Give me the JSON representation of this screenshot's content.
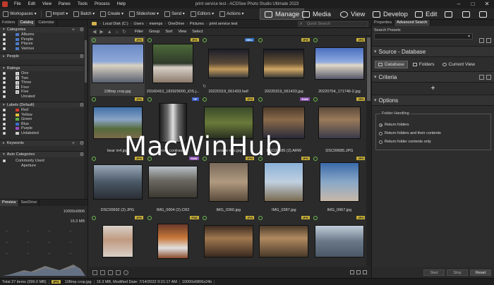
{
  "titlebar": {
    "menu": [
      "File",
      "Edit",
      "View",
      "Panes",
      "Tools",
      "Process",
      "Help"
    ],
    "title": "print service test - ACDSee Photo Studio Ultimate 2023"
  },
  "toolbar": {
    "buttons": [
      "Workspaces",
      "Import",
      "Batch",
      "Create",
      "Slideshow",
      "Send",
      "Editors",
      "Actions"
    ],
    "modes": [
      "Manage",
      "Media",
      "View",
      "Develop",
      "Edit"
    ]
  },
  "left_panel": {
    "tabs": [
      "Folders",
      "Catalog",
      "Calendar"
    ],
    "categories": {
      "title": "Categories",
      "items": [
        "Albums",
        "People",
        "Places",
        "Various"
      ],
      "colors": [
        "#4a7cc8",
        "#4a7cc8",
        "#4a7cc8",
        "#4a7cc8"
      ]
    },
    "people": {
      "title": "People"
    },
    "ratings": {
      "title": "Ratings",
      "items": [
        "One",
        "Two",
        "Three",
        "Four",
        "Five",
        "Unrated"
      ],
      "numbers": [
        "1",
        "2",
        "3",
        "4",
        "5",
        ""
      ]
    },
    "labels": {
      "title": "Labels (Default)",
      "items": [
        "Red",
        "Yellow",
        "Green",
        "Blue",
        "Purple",
        "Unlabeled"
      ],
      "colors": [
        "#d23b2e",
        "#e6c53a",
        "#58b048",
        "#3a6fd0",
        "#9a4bc0",
        "#cccccc"
      ]
    },
    "keywords": {
      "title": "Keywords"
    },
    "auto_categories": {
      "title": "Auto Categories",
      "items": [
        "Commonly Used",
        "Aperture"
      ]
    }
  },
  "preview": {
    "tabs": [
      "Preview",
      "SeeDrive"
    ],
    "dimensions": "10000x6806",
    "filesize": "15.3 MB",
    "dashes": [
      "--",
      "--",
      "--",
      "--",
      "--",
      "--",
      "--",
      "--",
      "--",
      "--",
      "--",
      "--"
    ]
  },
  "address": {
    "crumbs": [
      "Local Disk (C:)",
      "Users",
      "mwmps",
      "OneDrive",
      "Pictures",
      "print service test"
    ],
    "search_placeholder": "Quick Search"
  },
  "filterbar": {
    "buttons": [
      "Filter",
      "Group",
      "Sort",
      "View",
      "Select"
    ]
  },
  "grid": {
    "items": [
      {
        "name": "108mp crop.jpg",
        "badge": "JPG",
        "btype": "jpg",
        "sel": true
      },
      {
        "name": "20160410_183929000_iOS.j...",
        "badge": "JPG",
        "btype": "jpg",
        "sel": false
      },
      {
        "name": "20220319_061433.heif",
        "badge": "HEIC",
        "btype": "heic",
        "sel": false
      },
      {
        "name": "20220319_061433.jpg",
        "badge": "JPG",
        "btype": "jpg",
        "sel": false
      },
      {
        "name": "20220704_171746-2.jpg",
        "badge": "JPG",
        "btype": "jpg",
        "sel": false
      },
      {
        "name": "bear m4.jpg",
        "badge": "JPG",
        "btype": "jpg",
        "sel": false
      },
      {
        "name": "brook contrast.tif",
        "badge": "TIF",
        "btype": "tif",
        "sel": false
      },
      {
        "name": "canarie rms.jpg",
        "badge": "JPG",
        "btype": "jpg",
        "sel": false
      },
      {
        "name": "DSC00685 (2).ARW",
        "badge": "RAW",
        "btype": "raw",
        "sel": false
      },
      {
        "name": "DSC00685.JPG",
        "badge": "JPG",
        "btype": "jpg",
        "sel": false
      },
      {
        "name": "DSC00692 (2).JPG",
        "badge": "JPG",
        "btype": "jpg",
        "sel": false
      },
      {
        "name": "IMG_0004 (2).CR2",
        "badge": "RAW",
        "btype": "raw",
        "sel": false
      },
      {
        "name": "IMG_0360.jpg",
        "badge": "JPG",
        "btype": "jpg",
        "sel": false
      },
      {
        "name": "IMG_0387.jpg",
        "badge": "JPG",
        "btype": "jpg",
        "sel": false
      },
      {
        "name": "IMG_0967.jpg",
        "badge": "JPG",
        "btype": "jpg",
        "sel": false
      },
      {
        "name": "",
        "badge": "JPG",
        "btype": "jpg",
        "sel": false
      },
      {
        "name": "",
        "badge": "PSD",
        "btype": "psd",
        "sel": false
      },
      {
        "name": "",
        "badge": "JPG",
        "btype": "jpg",
        "sel": false
      },
      {
        "name": "",
        "badge": "JPG",
        "btype": "jpg",
        "sel": false
      },
      {
        "name": "",
        "badge": "JPG",
        "btype": "jpg",
        "sel": false
      }
    ]
  },
  "right_panel": {
    "tabs": [
      "Properties",
      "Advanced Search"
    ],
    "search_presets_label": "Search Presets",
    "source_title": "Source - Database",
    "source_buttons": [
      "Database",
      "Folders",
      "Current View"
    ],
    "criteria_title": "Criteria",
    "options_title": "Options",
    "folder_handling": "Folder Handling",
    "radios": [
      "Return folders",
      "Return folders and their contents",
      "Return folder contents only"
    ],
    "bottom_buttons": [
      "Start",
      "Stop",
      "Reset"
    ]
  },
  "statusbar": {
    "total": "Total 27 items  (399.0 MB)",
    "type": "JPG",
    "file": "108mp crop.jpg",
    "info": "15.3 MB, Modified Date: 7/14/2022 9:21:17 AM",
    "dims": "10000x6806x24b"
  },
  "watermark": "MacWinHub"
}
